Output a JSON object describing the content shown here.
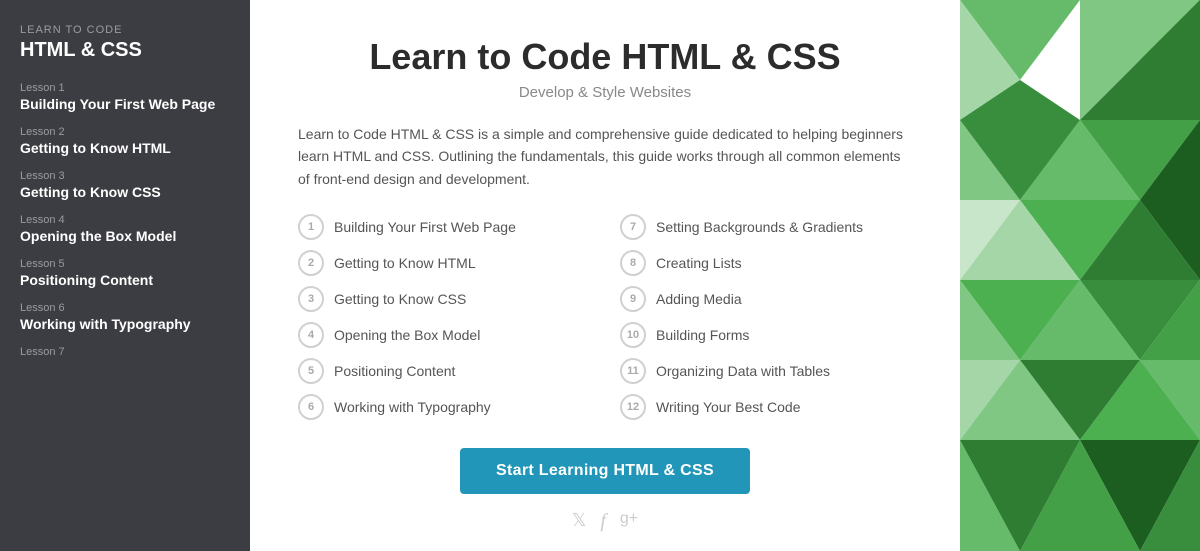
{
  "sidebar": {
    "header_top": "Learn to Code",
    "header_title": "HTML & CSS",
    "lessons": [
      {
        "number": "Lesson 1",
        "title": "Building Your First Web Page"
      },
      {
        "number": "Lesson 2",
        "title": "Getting to Know HTML"
      },
      {
        "number": "Lesson 3",
        "title": "Getting to Know CSS"
      },
      {
        "number": "Lesson 4",
        "title": "Opening the Box Model"
      },
      {
        "number": "Lesson 5",
        "title": "Positioning Content"
      },
      {
        "number": "Lesson 6",
        "title": "Working with Typography"
      },
      {
        "number": "Lesson 7",
        "title": ""
      }
    ]
  },
  "main": {
    "title": "Learn to Code HTML & CSS",
    "subtitle": "Develop & Style Websites",
    "description": "Learn to Code HTML & CSS is a simple and comprehensive guide dedicated to helping beginners learn HTML and CSS. Outlining the fundamentals, this guide works through all common elements of front-end design and development.",
    "cta_label": "Start Learning HTML & CSS",
    "lessons_left": [
      {
        "num": "1",
        "name": "Building Your First Web Page"
      },
      {
        "num": "2",
        "name": "Getting to Know HTML"
      },
      {
        "num": "3",
        "name": "Getting to Know CSS"
      },
      {
        "num": "4",
        "name": "Opening the Box Model"
      },
      {
        "num": "5",
        "name": "Positioning Content"
      },
      {
        "num": "6",
        "name": "Working with Typography"
      }
    ],
    "lessons_right": [
      {
        "num": "7",
        "name": "Setting Backgrounds & Gradients"
      },
      {
        "num": "8",
        "name": "Creating Lists"
      },
      {
        "num": "9",
        "name": "Adding Media"
      },
      {
        "num": "10",
        "name": "Building Forms"
      },
      {
        "num": "11",
        "name": "Organizing Data with Tables"
      },
      {
        "num": "12",
        "name": "Writing Your Best Code"
      }
    ],
    "social": [
      "twitter-icon",
      "facebook-icon",
      "googleplus-icon"
    ]
  }
}
